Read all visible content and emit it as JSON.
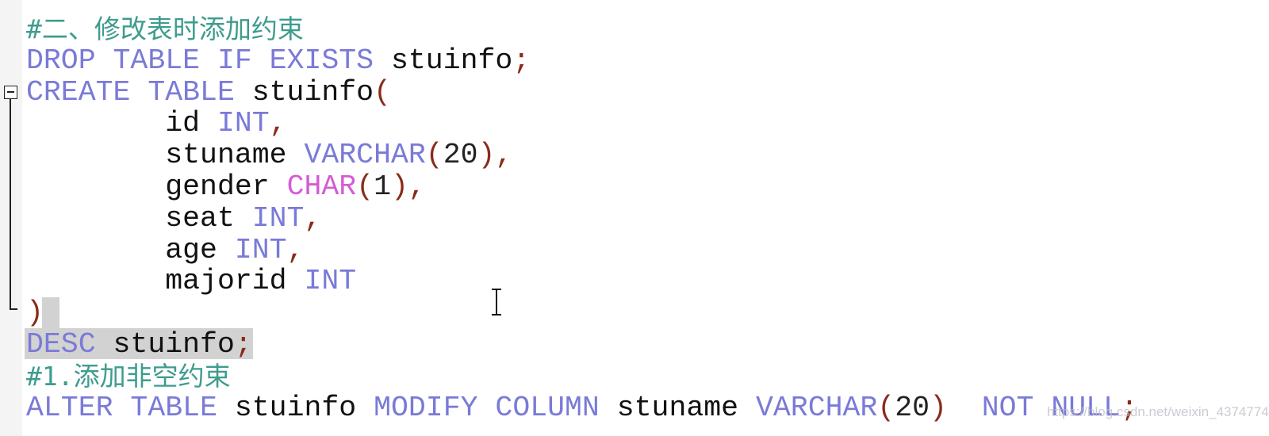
{
  "editor": {
    "lines": [
      [
        {
          "t": "#二、修改表时添加约束",
          "c": "cm"
        }
      ],
      [
        {
          "t": "DROP TABLE IF EXISTS",
          "c": "kw"
        },
        {
          "t": " stuinfo",
          "c": "id"
        },
        {
          "t": ";",
          "c": "pn"
        }
      ],
      [
        {
          "t": "CREATE TABLE",
          "c": "kw"
        },
        {
          "t": " stuinfo",
          "c": "id"
        },
        {
          "t": "(",
          "c": "pn"
        }
      ],
      [
        {
          "t": "        id ",
          "c": "id"
        },
        {
          "t": "INT",
          "c": "kw"
        },
        {
          "t": ",",
          "c": "pn"
        }
      ],
      [
        {
          "t": "        stuname ",
          "c": "id"
        },
        {
          "t": "VARCHAR",
          "c": "kw"
        },
        {
          "t": "(",
          "c": "pn"
        },
        {
          "t": "20",
          "c": "num"
        },
        {
          "t": "),",
          "c": "pn"
        }
      ],
      [
        {
          "t": "        gender ",
          "c": "id"
        },
        {
          "t": "CHAR",
          "c": "kw2"
        },
        {
          "t": "(",
          "c": "pn"
        },
        {
          "t": "1",
          "c": "num"
        },
        {
          "t": "),",
          "c": "pn"
        }
      ],
      [
        {
          "t": "        seat ",
          "c": "id"
        },
        {
          "t": "INT",
          "c": "kw"
        },
        {
          "t": ",",
          "c": "pn"
        }
      ],
      [
        {
          "t": "        age ",
          "c": "id"
        },
        {
          "t": "INT",
          "c": "kw"
        },
        {
          "t": ",",
          "c": "pn"
        }
      ],
      [
        {
          "t": "        majorid ",
          "c": "id"
        },
        {
          "t": "INT",
          "c": "kw"
        }
      ],
      [
        {
          "t": ")",
          "c": "pn"
        }
      ],
      [
        {
          "t": "DESC",
          "c": "kw"
        },
        {
          "t": " stuinfo",
          "c": "id"
        },
        {
          "t": ";",
          "c": "pn"
        }
      ],
      [
        {
          "t": "#1.添加非空约束",
          "c": "cm"
        }
      ],
      [
        {
          "t": "ALTER TABLE",
          "c": "kw"
        },
        {
          "t": " stuinfo ",
          "c": "id"
        },
        {
          "t": "MODIFY COLUMN",
          "c": "kw"
        },
        {
          "t": " stuname ",
          "c": "id"
        },
        {
          "t": "VARCHAR",
          "c": "kw"
        },
        {
          "t": "(",
          "c": "pn"
        },
        {
          "t": "20",
          "c": "num"
        },
        {
          "t": ")",
          "c": "pn"
        },
        {
          "t": "  ",
          "c": "id"
        },
        {
          "t": "NOT NULL",
          "c": "kw"
        },
        {
          "t": ";",
          "c": "pn"
        }
      ]
    ],
    "fold_icon": "collapse-minus-icon",
    "cursor_icon": "text-ibeam-cursor-icon"
  },
  "watermark": "https://blog.csdn.net/weixin_43747748",
  "colors": {
    "keyword": "#7a7ad8",
    "type_char": "#d45cd4",
    "comment": "#3e9c8e",
    "punctuation": "#8a2a1a",
    "selection": "#d2d2d2"
  }
}
